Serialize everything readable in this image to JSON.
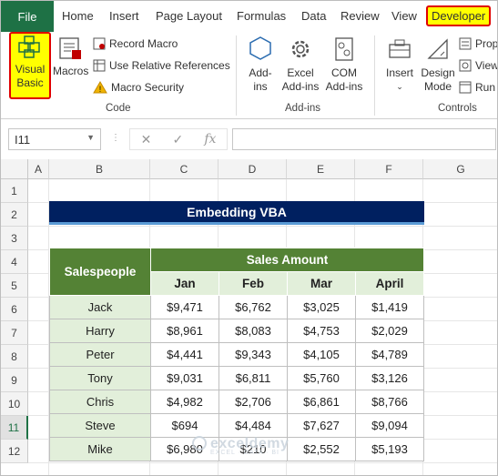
{
  "tabs": [
    "File",
    "Home",
    "Insert",
    "Page Layout",
    "Formulas",
    "Data",
    "Review",
    "View",
    "Developer"
  ],
  "ribbon": {
    "visual_basic": [
      "Visual",
      "Basic"
    ],
    "macros": "Macros",
    "record_macro": "Record Macro",
    "relative_refs": "Use Relative References",
    "macro_security": "Macro Security",
    "code_group": "Code",
    "addins": [
      "Add-",
      "ins"
    ],
    "excel_addins": [
      "Excel",
      "Add-ins"
    ],
    "com_addins": [
      "COM",
      "Add-ins"
    ],
    "addins_group": "Add-ins",
    "insert": "Insert",
    "design_mode": [
      "Design",
      "Mode"
    ],
    "properties": "Prop",
    "view_code": "View",
    "run_dialog": "Run",
    "controls_group": "Controls"
  },
  "formula_bar": {
    "name_box": "I11",
    "fx": "fx",
    "formula": ""
  },
  "columns": [
    "A",
    "B",
    "C",
    "D",
    "E",
    "F",
    "G"
  ],
  "rows": [
    "1",
    "2",
    "3",
    "4",
    "5",
    "6",
    "7",
    "8",
    "9",
    "10",
    "11",
    "12"
  ],
  "selected_row": "11",
  "sheet": {
    "title": "Embedding VBA",
    "header_salespeople": "Salespeople",
    "header_sales_amount": "Sales Amount",
    "months": [
      "Jan",
      "Feb",
      "Mar",
      "April"
    ],
    "records": [
      {
        "name": "Jack",
        "values": [
          "$9,471",
          "$6,762",
          "$3,025",
          "$1,419"
        ]
      },
      {
        "name": "Harry",
        "values": [
          "$8,961",
          "$8,083",
          "$4,753",
          "$2,029"
        ]
      },
      {
        "name": "Peter",
        "values": [
          "$4,441",
          "$9,343",
          "$4,105",
          "$4,789"
        ]
      },
      {
        "name": "Tony",
        "values": [
          "$9,031",
          "$6,811",
          "$5,760",
          "$3,126"
        ]
      },
      {
        "name": "Chris",
        "values": [
          "$4,982",
          "$2,706",
          "$6,861",
          "$8,766"
        ]
      },
      {
        "name": "Steve",
        "values": [
          "$694",
          "$4,484",
          "$7,627",
          "$9,094"
        ]
      },
      {
        "name": "Mike",
        "values": [
          "$6,980",
          "$210",
          "$2,552",
          "$5,193"
        ]
      }
    ]
  },
  "watermark": {
    "brand": "exceldemy",
    "tagline": "EXCEL · DATA · BI"
  },
  "colors": {
    "file_tab": "#1e7145",
    "highlight": "#ffff00",
    "outline": "#e00000",
    "title_bg": "#002060",
    "header_bg": "#548235",
    "name_bg": "#e2efda"
  }
}
